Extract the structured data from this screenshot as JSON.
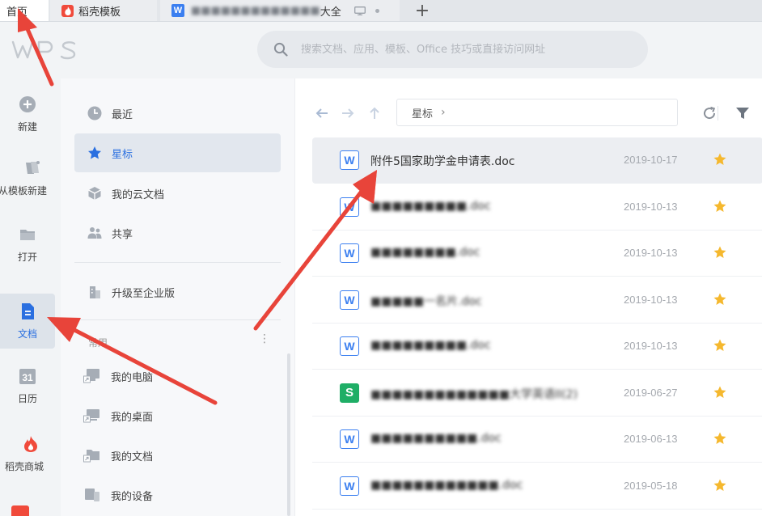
{
  "tabs": [
    {
      "label": "首页"
    },
    {
      "label": "稻壳模板"
    },
    {
      "label": "大全",
      "blurred_prefix": "■■■■■■■■■■■■■"
    }
  ],
  "new_tab_label": "+",
  "search": {
    "placeholder": "搜索文档、应用、模板、Office 技巧或直接访问网址"
  },
  "rail": [
    {
      "label": "新建",
      "icon": "plus-circle-icon"
    },
    {
      "label": "从模板新建",
      "icon": "template-icon"
    },
    {
      "label": "打开",
      "icon": "folder-icon"
    },
    {
      "label": "文档",
      "icon": "document-icon"
    },
    {
      "label": "日历",
      "icon": "calendar-icon"
    },
    {
      "label": "稻壳商城",
      "icon": "docer-store-icon"
    }
  ],
  "nav": {
    "items": [
      {
        "label": "最近",
        "icon": "clock-icon"
      },
      {
        "label": "星标",
        "icon": "star-icon"
      },
      {
        "label": "我的云文档",
        "icon": "cloud-box-icon"
      },
      {
        "label": "共享",
        "icon": "people-icon"
      },
      {
        "label": "升级至企业版",
        "icon": "building-icon"
      }
    ],
    "section_title": "常用",
    "locations": [
      {
        "label": "我的电脑"
      },
      {
        "label": "我的桌面"
      },
      {
        "label": "我的文档"
      },
      {
        "label": "我的设备"
      }
    ]
  },
  "breadcrumb": {
    "label": "星标"
  },
  "files": [
    {
      "name": "附件5国家助学金申请表.doc",
      "date": "2019-10-17",
      "type": "W",
      "blur": false
    },
    {
      "name": "■■■■■■■■■.doc",
      "date": "2019-10-13",
      "type": "W",
      "blur": true
    },
    {
      "name": "■■■■■■■■.doc",
      "date": "2019-10-13",
      "type": "W",
      "blur": true
    },
    {
      "name": "■■■■■一名片.doc",
      "date": "2019-10-13",
      "type": "W",
      "blur": true
    },
    {
      "name": "■■■■■■■■■.doc",
      "date": "2019-10-13",
      "type": "W",
      "blur": true
    },
    {
      "name": "■■■■■■■■■■■■■大学英语II(2)",
      "date": "2019-06-27",
      "type": "S",
      "blur": true
    },
    {
      "name": "■■■■■■■■■■.doc",
      "date": "2019-06-13",
      "type": "W",
      "blur": true
    },
    {
      "name": "■■■■■■■■■■■■.doc",
      "date": "2019-05-18",
      "type": "W",
      "blur": true
    }
  ],
  "colors": {
    "accent": "#2a6fe0",
    "star": "#f5b82e",
    "arrow": "#e8443a"
  }
}
